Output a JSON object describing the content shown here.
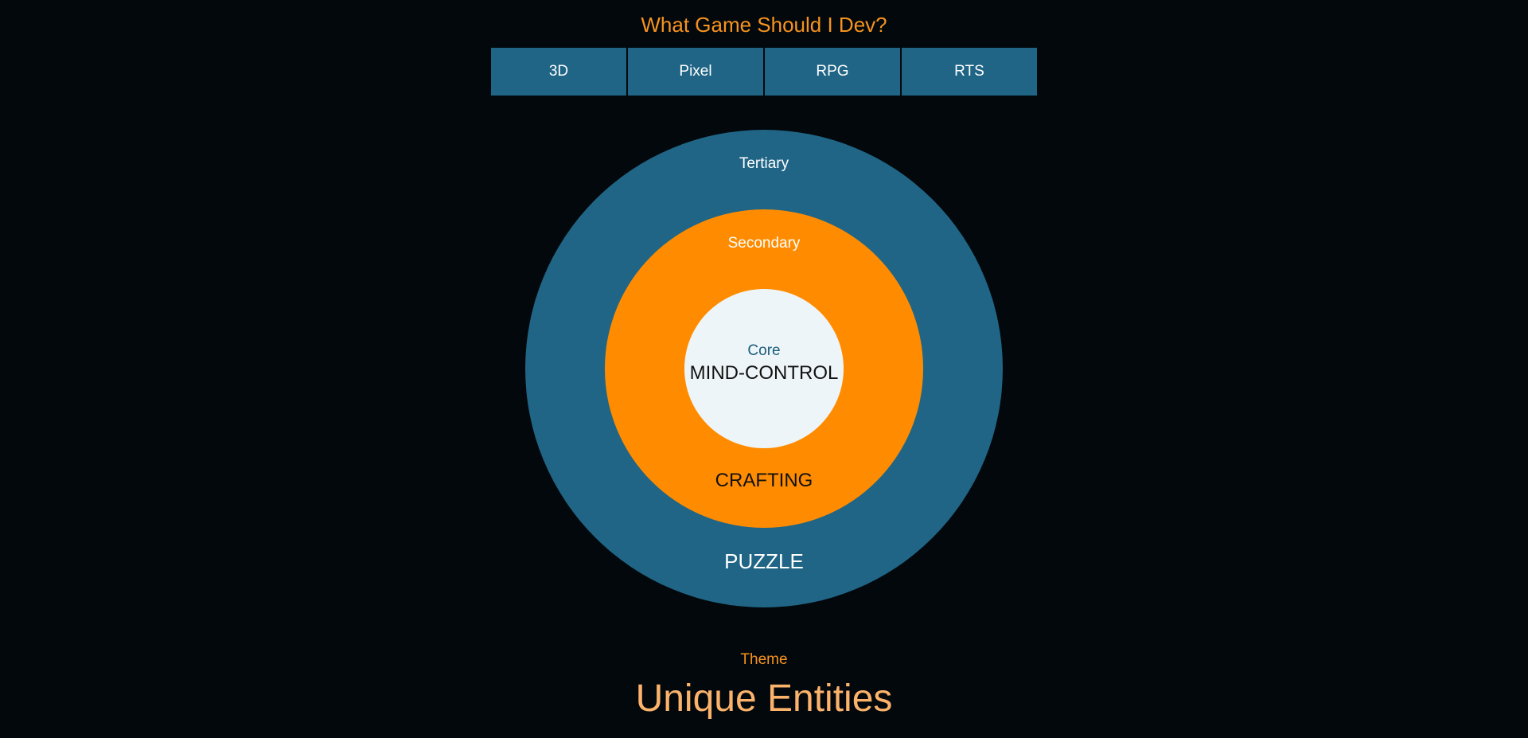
{
  "app": {
    "title": "What Game Should I Dev?"
  },
  "tags": [
    {
      "label": "3D"
    },
    {
      "label": "Pixel"
    },
    {
      "label": "RPG"
    },
    {
      "label": "RTS"
    }
  ],
  "rings": {
    "tertiary": {
      "label": "Tertiary",
      "value": "PUZZLE",
      "color": "#206586"
    },
    "secondary": {
      "label": "Secondary",
      "value": "CRAFTING",
      "color": "#ff8c00"
    },
    "core": {
      "label": "Core",
      "value": "MIND-CONTROL",
      "color": "#eef5f8"
    }
  },
  "theme": {
    "label": "Theme",
    "value": "Unique Entities"
  },
  "colors": {
    "background": "#02080c",
    "accent_orange": "#f7931e",
    "accent_blue": "#206586",
    "theme_text": "#fbb26b"
  }
}
